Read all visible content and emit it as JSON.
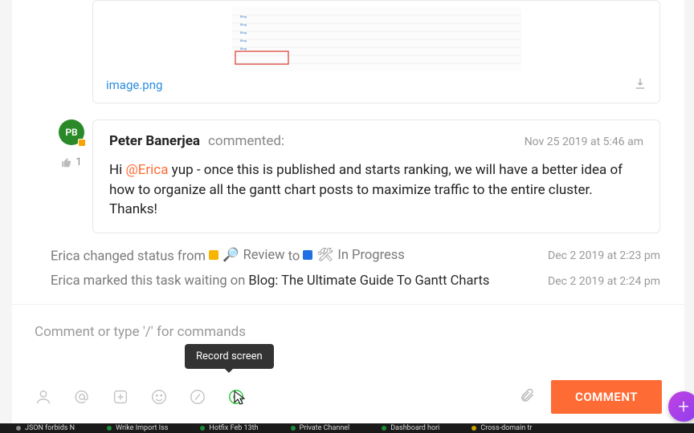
{
  "attachment": {
    "filename": "image.png"
  },
  "comment": {
    "avatar_initials": "PB",
    "author": "Peter Banerjea",
    "verb": "commented:",
    "timestamp": "Nov 25 2019 at 5:46 am",
    "like_count": "1",
    "greeting": "Hi ",
    "mention": "@Erica",
    "body_rest": " yup - once this is published and starts ranking, we will have a better idea of how to organize all the gantt chart posts to maximize traffic to the entire cluster. Thanks!"
  },
  "activity1": {
    "prefix": "Erica changed status from ",
    "status1_icon": "🔎",
    "status1_label": "Review",
    "mid": " to ",
    "status2_icon": "🛠",
    "status2_label": "In Progress",
    "timestamp": "Dec 2 2019 at 2:23 pm"
  },
  "activity2": {
    "prefix": "Erica marked this task waiting on ",
    "task": "Blog: The Ultimate Guide To Gantt Charts",
    "timestamp": "Dec 2 2019 at 2:24 pm"
  },
  "composer": {
    "placeholder": "Comment or type '/' for commands",
    "button": "COMMENT",
    "tooltip": "Record screen"
  },
  "tabs": {
    "t1": "JSON forbids N",
    "t2": "Wrike Import Iss",
    "t3": "Hotfix Feb 13th",
    "t4": "Private Channel",
    "t5": "Dashboard hori",
    "t6": "Cross-domain tr"
  }
}
